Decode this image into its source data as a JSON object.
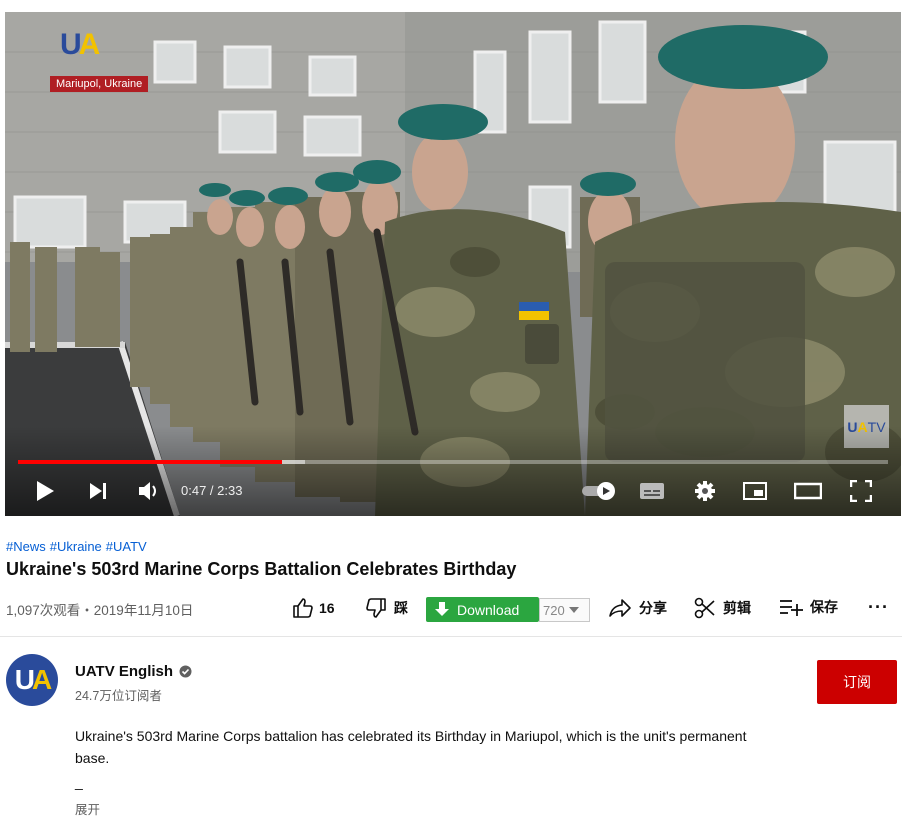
{
  "video": {
    "channel_bug": {
      "logo_u": "U",
      "logo_a": "A",
      "location": "Mariupol, Ukraine"
    },
    "watermark": {
      "u": "U",
      "a": "A",
      "tv": "TV"
    },
    "progress_fraction": 0.304,
    "loaded_fraction": 0.33,
    "time_current": "0:47",
    "time_separator": " / ",
    "time_total": "2:33",
    "controls": [
      "play-icon",
      "next-icon",
      "volume-icon",
      "autoplay-toggle-icon",
      "subtitles-icon",
      "settings-gear-icon",
      "miniplayer-icon",
      "theater-mode-icon",
      "fullscreen-icon"
    ]
  },
  "hashtags": [
    "#News",
    "#Ukraine",
    "#UATV"
  ],
  "title": "Ukraine's 503rd Marine Corps Battalion Celebrates Birthday",
  "meta": {
    "views_date": "1,097次观看・2019年11月10日",
    "like_count": "16",
    "dislike_label": "踩",
    "download_label": "Download",
    "quality_value": "720",
    "share_label": "分享",
    "clip_label": "剪辑",
    "save_label": "保存",
    "more_label": "···"
  },
  "channel": {
    "avatar_u": "U",
    "avatar_a": "A",
    "name": "UATV English",
    "subscribers": "24.7万位订阅者",
    "subscribe_label": "订阅"
  },
  "description": {
    "text": "Ukraine's 503rd Marine Corps battalion has celebrated its Birthday in Mariupol, which is the unit's permanent base.",
    "dash": "_",
    "expand_label": "展开"
  },
  "colors": {
    "progress_played": "#ff0000",
    "download_button": "#2ba640",
    "subscribe_button": "#cc0000",
    "hashtag_link": "#065fd4",
    "beret": "#1f6b66"
  }
}
